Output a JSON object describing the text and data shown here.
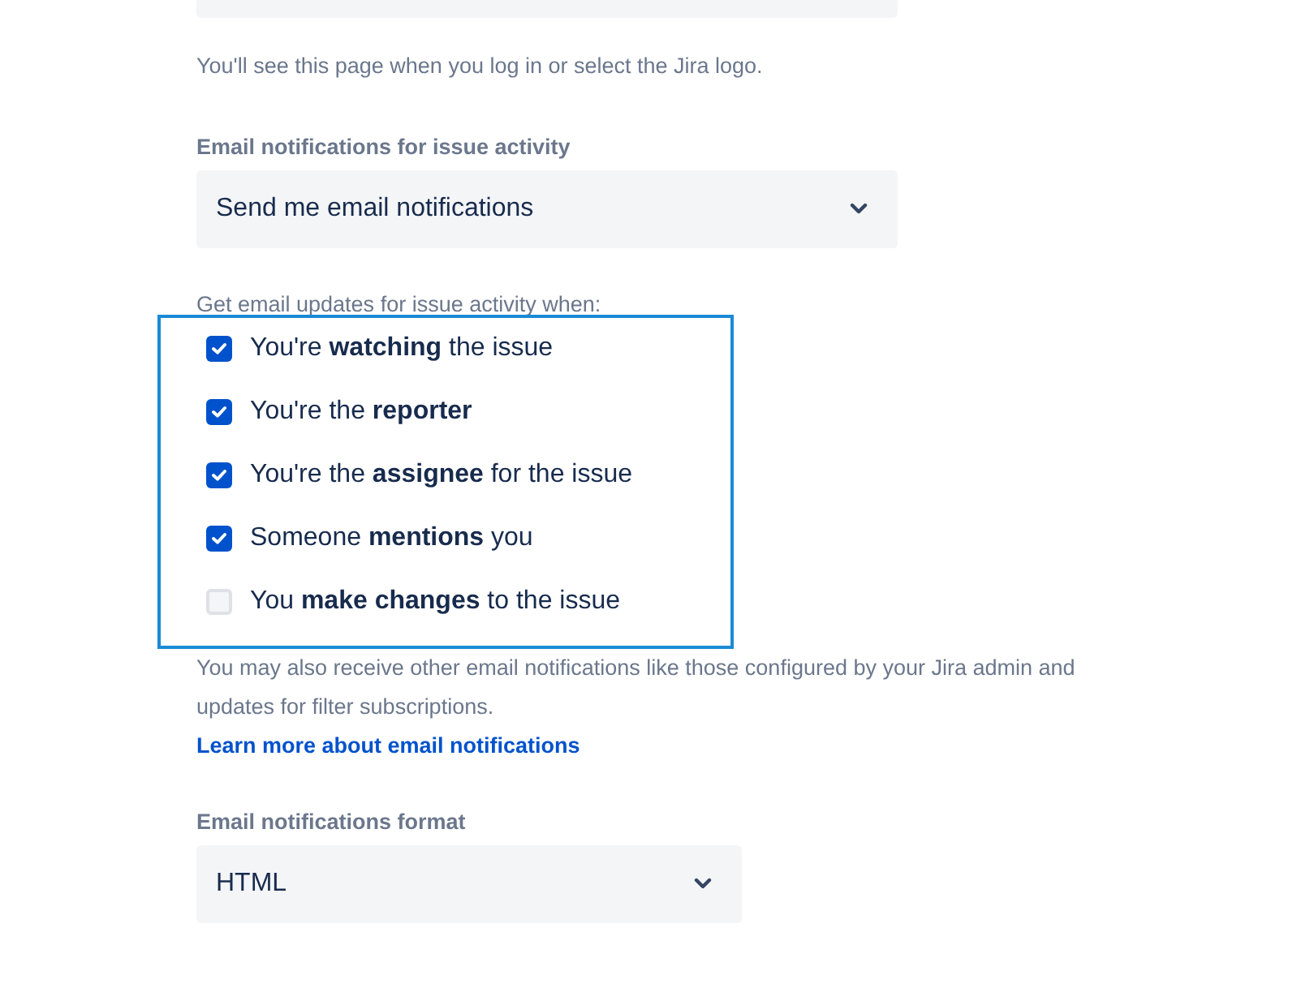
{
  "home_help": "You'll see this page when you log in or select the Jira logo.",
  "issue_activity": {
    "label": "Email notifications for issue activity",
    "value": "Send me email notifications"
  },
  "updates_heading": "Get email updates for issue activity when:",
  "options": [
    {
      "label": "You're **watching** the issue",
      "checked": true
    },
    {
      "label": "You're the **reporter**",
      "checked": true
    },
    {
      "label": "You're the **assignee** for the issue",
      "checked": true
    },
    {
      "label": "Someone **mentions** you",
      "checked": true
    },
    {
      "label": "You **make changes** to the issue",
      "checked": false
    }
  ],
  "note": "You may also receive other email notifications like those configured by your Jira admin and updates for filter subscriptions.",
  "learn_more_link": "Learn more about email notifications",
  "format": {
    "label": "Email notifications format",
    "value": "HTML"
  }
}
